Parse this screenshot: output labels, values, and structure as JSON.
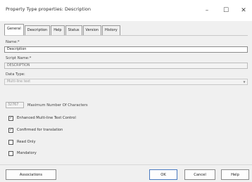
{
  "window": {
    "title": "Property Type properties: Description"
  },
  "window_controls": {
    "minimize": "–",
    "maximize": "☐",
    "close": "✕"
  },
  "tabs": [
    {
      "label": "General"
    },
    {
      "label": "Description"
    },
    {
      "label": "Help"
    },
    {
      "label": "Status"
    },
    {
      "label": "Version"
    },
    {
      "label": "History"
    }
  ],
  "general": {
    "name_label": "Name:*",
    "name_value": "Description",
    "script_name_label": "Script Name:*",
    "script_name_value": "DESCRIPTION",
    "data_type_label": "Data Type:",
    "data_type_value": "Multi-line text",
    "max_chars_value": "32767",
    "max_chars_label": "Maximum Number Of Characters",
    "enhanced_label": "Enhanced Multi-line Text Control",
    "enhanced_checked": "✓",
    "confirmed_label": "Confirmed for translation",
    "confirmed_checked": "✓",
    "readonly_label": "Read Only",
    "mandatory_label": "Mandatory"
  },
  "buttons": {
    "associations": "Associations",
    "ok": "OK",
    "cancel": "Cancel",
    "help": "Help"
  }
}
